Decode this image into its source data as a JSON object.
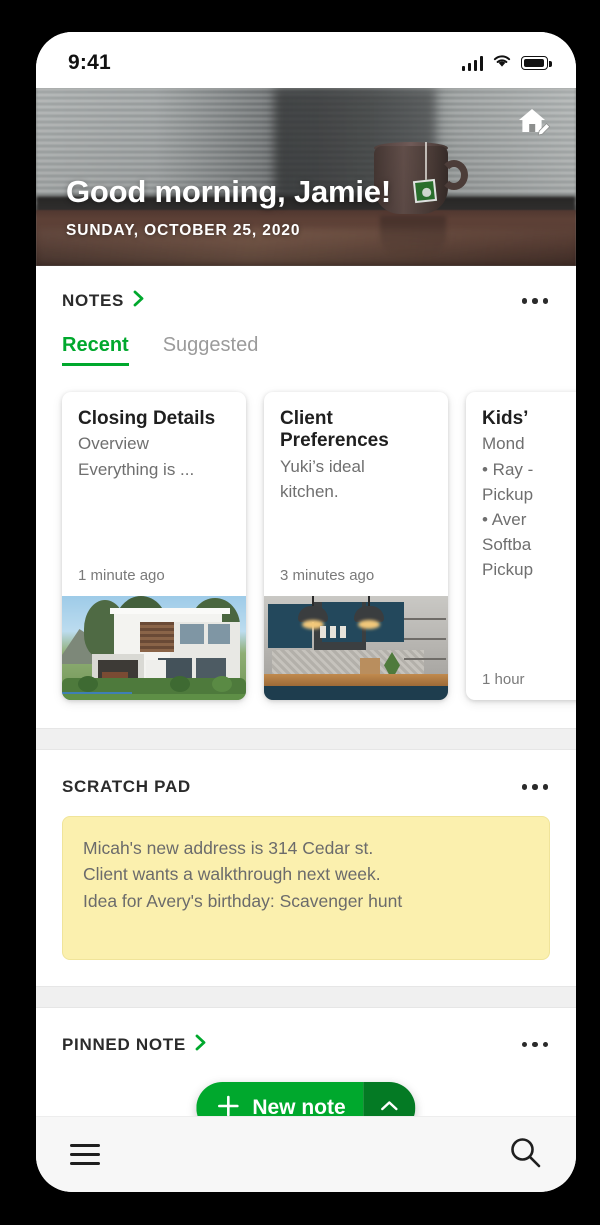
{
  "status_bar": {
    "time": "9:41",
    "signal_icon": "signal-bars-icon",
    "wifi_icon": "wifi-icon",
    "battery_icon": "battery-full-icon"
  },
  "hero": {
    "greeting": "Good morning, Jamie!",
    "date": "SUNDAY, OCTOBER 25, 2020",
    "action_icon": "home-edit-icon"
  },
  "notes": {
    "title": "NOTES",
    "chevron_icon": "chevron-right-icon",
    "overflow_icon": "more-options-icon",
    "tabs": [
      {
        "label": "Recent",
        "active": true
      },
      {
        "label": "Suggested",
        "active": false
      }
    ],
    "cards": [
      {
        "title": "Closing Details",
        "snippet_line1": "Overview",
        "snippet_line2": "Everything is ...",
        "time": "1 minute ago",
        "image": "modern-house-photo"
      },
      {
        "title": "Client Preferences",
        "snippet_line1": "Yuki’s ideal",
        "snippet_line2": "kitchen.",
        "time": "3 minutes ago",
        "image": "navy-kitchen-photo"
      },
      {
        "title": "Kids’",
        "snippet_line1": "Mond",
        "snippet_line2": "• Ray -",
        "snippet_line3": "Pickup",
        "snippet_line4": "• Aver",
        "snippet_line5": "Softba",
        "snippet_line6": "Pickup",
        "time": "1 hour",
        "image": ""
      }
    ]
  },
  "scratch_pad": {
    "title": "SCRATCH PAD",
    "overflow_icon": "more-options-icon",
    "lines": [
      "Micah's new address is 314 Cedar st.",
      "Client wants a walkthrough next week.",
      "Idea for Avery's birthday: Scavenger hunt"
    ]
  },
  "pinned_note": {
    "title": "PINNED NOTE",
    "chevron_icon": "chevron-right-icon",
    "overflow_icon": "more-options-icon"
  },
  "fab": {
    "label": "New note",
    "plus_icon": "plus-icon",
    "expand_icon": "chevron-up-icon"
  },
  "bottom_bar": {
    "menu_icon": "hamburger-menu-icon",
    "search_icon": "search-icon"
  },
  "colors": {
    "accent_green": "#00a82d",
    "fab_dark_green": "#047a24",
    "scratch_yellow": "#fbf0ae",
    "divider_gray": "#f0f0f0"
  }
}
